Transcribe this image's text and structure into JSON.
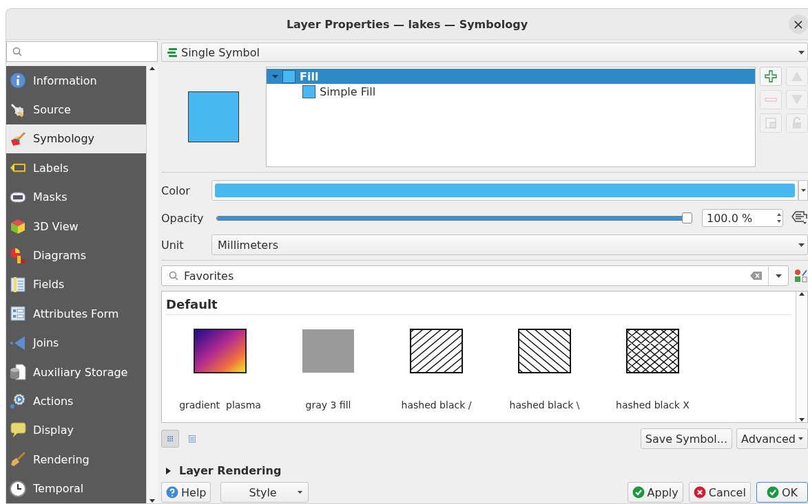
{
  "window": {
    "title": "Layer Properties — lakes — Symbology",
    "close": "×"
  },
  "sidebar": {
    "items": [
      {
        "label": "Information",
        "selected": false
      },
      {
        "label": "Source",
        "selected": false
      },
      {
        "label": "Symbology",
        "selected": true
      },
      {
        "label": "Labels",
        "selected": false
      },
      {
        "label": "Masks",
        "selected": false
      },
      {
        "label": "3D View",
        "selected": false
      },
      {
        "label": "Diagrams",
        "selected": false
      },
      {
        "label": "Fields",
        "selected": false
      },
      {
        "label": "Attributes Form",
        "selected": false
      },
      {
        "label": "Joins",
        "selected": false
      },
      {
        "label": "Auxiliary Storage",
        "selected": false
      },
      {
        "label": "Actions",
        "selected": false
      },
      {
        "label": "Display",
        "selected": false
      },
      {
        "label": "Rendering",
        "selected": false
      },
      {
        "label": "Temporal",
        "selected": false
      }
    ]
  },
  "renderer": {
    "value": "Single Symbol"
  },
  "symbol_tree": [
    {
      "label": "Fill",
      "selected": true,
      "expanded": true,
      "color": "#48b8f0",
      "children": [
        {
          "label": "Simple Fill",
          "selected": false,
          "color": "#48b8f0"
        }
      ]
    }
  ],
  "symbol_buttons": [
    {
      "kind": "add",
      "disabled": false
    },
    {
      "kind": "up",
      "disabled": true
    },
    {
      "kind": "remove",
      "disabled": true
    },
    {
      "kind": "down",
      "disabled": true
    },
    {
      "kind": "duplicate",
      "disabled": true
    },
    {
      "kind": "lock",
      "disabled": true
    }
  ],
  "color": {
    "label": "Color",
    "color": "#48b8f0"
  },
  "opacity": {
    "label": "Opacity",
    "level": 1.0,
    "value": "100.0 %"
  },
  "unit": {
    "label": "Unit",
    "value": "Millimeters"
  },
  "library_search": {
    "value": "Favorites"
  },
  "library": {
    "group": "Default",
    "symbols": [
      {
        "name": "gradient  plasma",
        "kind": "gradient"
      },
      {
        "name": "gray 3 fill",
        "kind": "solid"
      },
      {
        "name": "hashed black /",
        "kind": "hatch-forward"
      },
      {
        "name": "hashed black \\",
        "kind": "hatch-back"
      },
      {
        "name": "hashed black X",
        "kind": "hatch-cross"
      }
    ]
  },
  "view_modes": [
    {
      "kind": "icons",
      "selected": true
    },
    {
      "kind": "list",
      "selected": false
    }
  ],
  "save_symbol": "Save Symbol...",
  "advanced": "Advanced",
  "layer_rendering": {
    "label": "Layer Rendering",
    "expanded": false
  },
  "buttons": [
    {
      "kind": "help",
      "label": "Help"
    },
    {
      "kind": "style",
      "label": "Style"
    },
    {
      "kind": "apply",
      "label": "Apply"
    },
    {
      "kind": "cancel",
      "label": "Cancel"
    },
    {
      "kind": "ok",
      "label": "OK"
    }
  ]
}
